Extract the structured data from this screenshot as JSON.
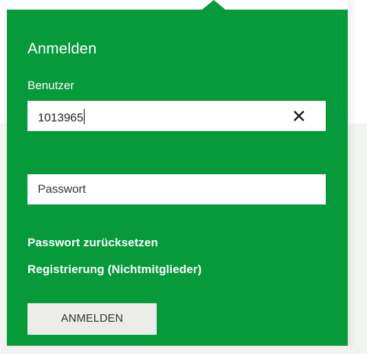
{
  "login_panel": {
    "title": "Anmelden",
    "username_label": "Benutzer",
    "username_value": "1013965",
    "password_placeholder": "Passwort",
    "links": {
      "reset_password": "Passwort zurücksetzen",
      "register": "Registrierung (Nichtmitglieder)"
    },
    "submit_label": "ANMELDEN"
  },
  "icons": {
    "clear": "close-icon"
  },
  "colors": {
    "panel_green": "#079a3a",
    "button_bg": "#ececea",
    "text_dark": "#222222",
    "white": "#ffffff"
  }
}
